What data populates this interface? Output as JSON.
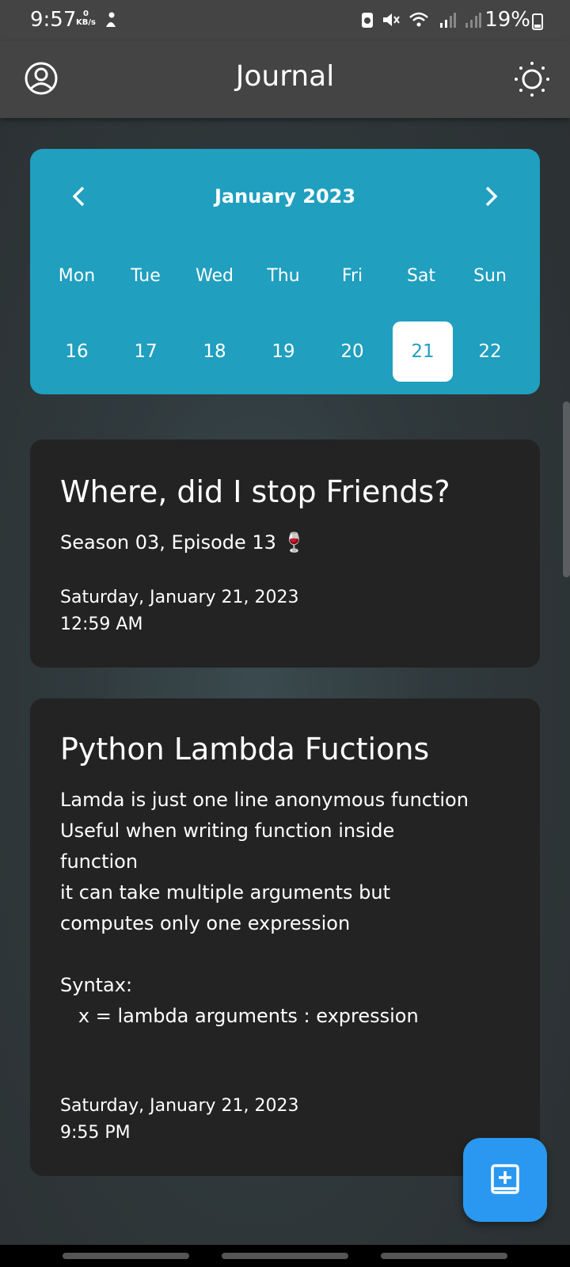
{
  "status_bar": {
    "time": "9:57",
    "net_speed_value": "0",
    "net_speed_unit": "KB/s",
    "battery": "19%"
  },
  "app_bar": {
    "title": "Journal",
    "left_icon": "profile-icon",
    "right_icon": "brightness-icon"
  },
  "calendar": {
    "month_label": "January 2023",
    "days": [
      {
        "label": "Mon",
        "date": "16"
      },
      {
        "label": "Tue",
        "date": "17"
      },
      {
        "label": "Wed",
        "date": "18"
      },
      {
        "label": "Thu",
        "date": "19"
      },
      {
        "label": "Fri",
        "date": "20"
      },
      {
        "label": "Sat",
        "date": "21"
      },
      {
        "label": "Sun",
        "date": "22"
      }
    ],
    "selected_date": "21",
    "accent_color": "#209fbf"
  },
  "entries": [
    {
      "title": "Where, did I stop Friends?",
      "body": "Season 03, Episode 13 🍷",
      "date": "Saturday, January 21, 2023",
      "time": "12:59 AM"
    },
    {
      "title": "Python Lambda Fuctions",
      "body": "Lamda is just one line anonymous function\nUseful when writing function inside\nfunction\nit can take multiple arguments but\ncomputes only one expression\n\nSyntax:\n   x = lambda arguments : expression",
      "date": "Saturday, January 21, 2023",
      "time": "9:55 PM"
    }
  ],
  "fab": {
    "icon": "add-note-icon",
    "color": "#2a98f0"
  }
}
